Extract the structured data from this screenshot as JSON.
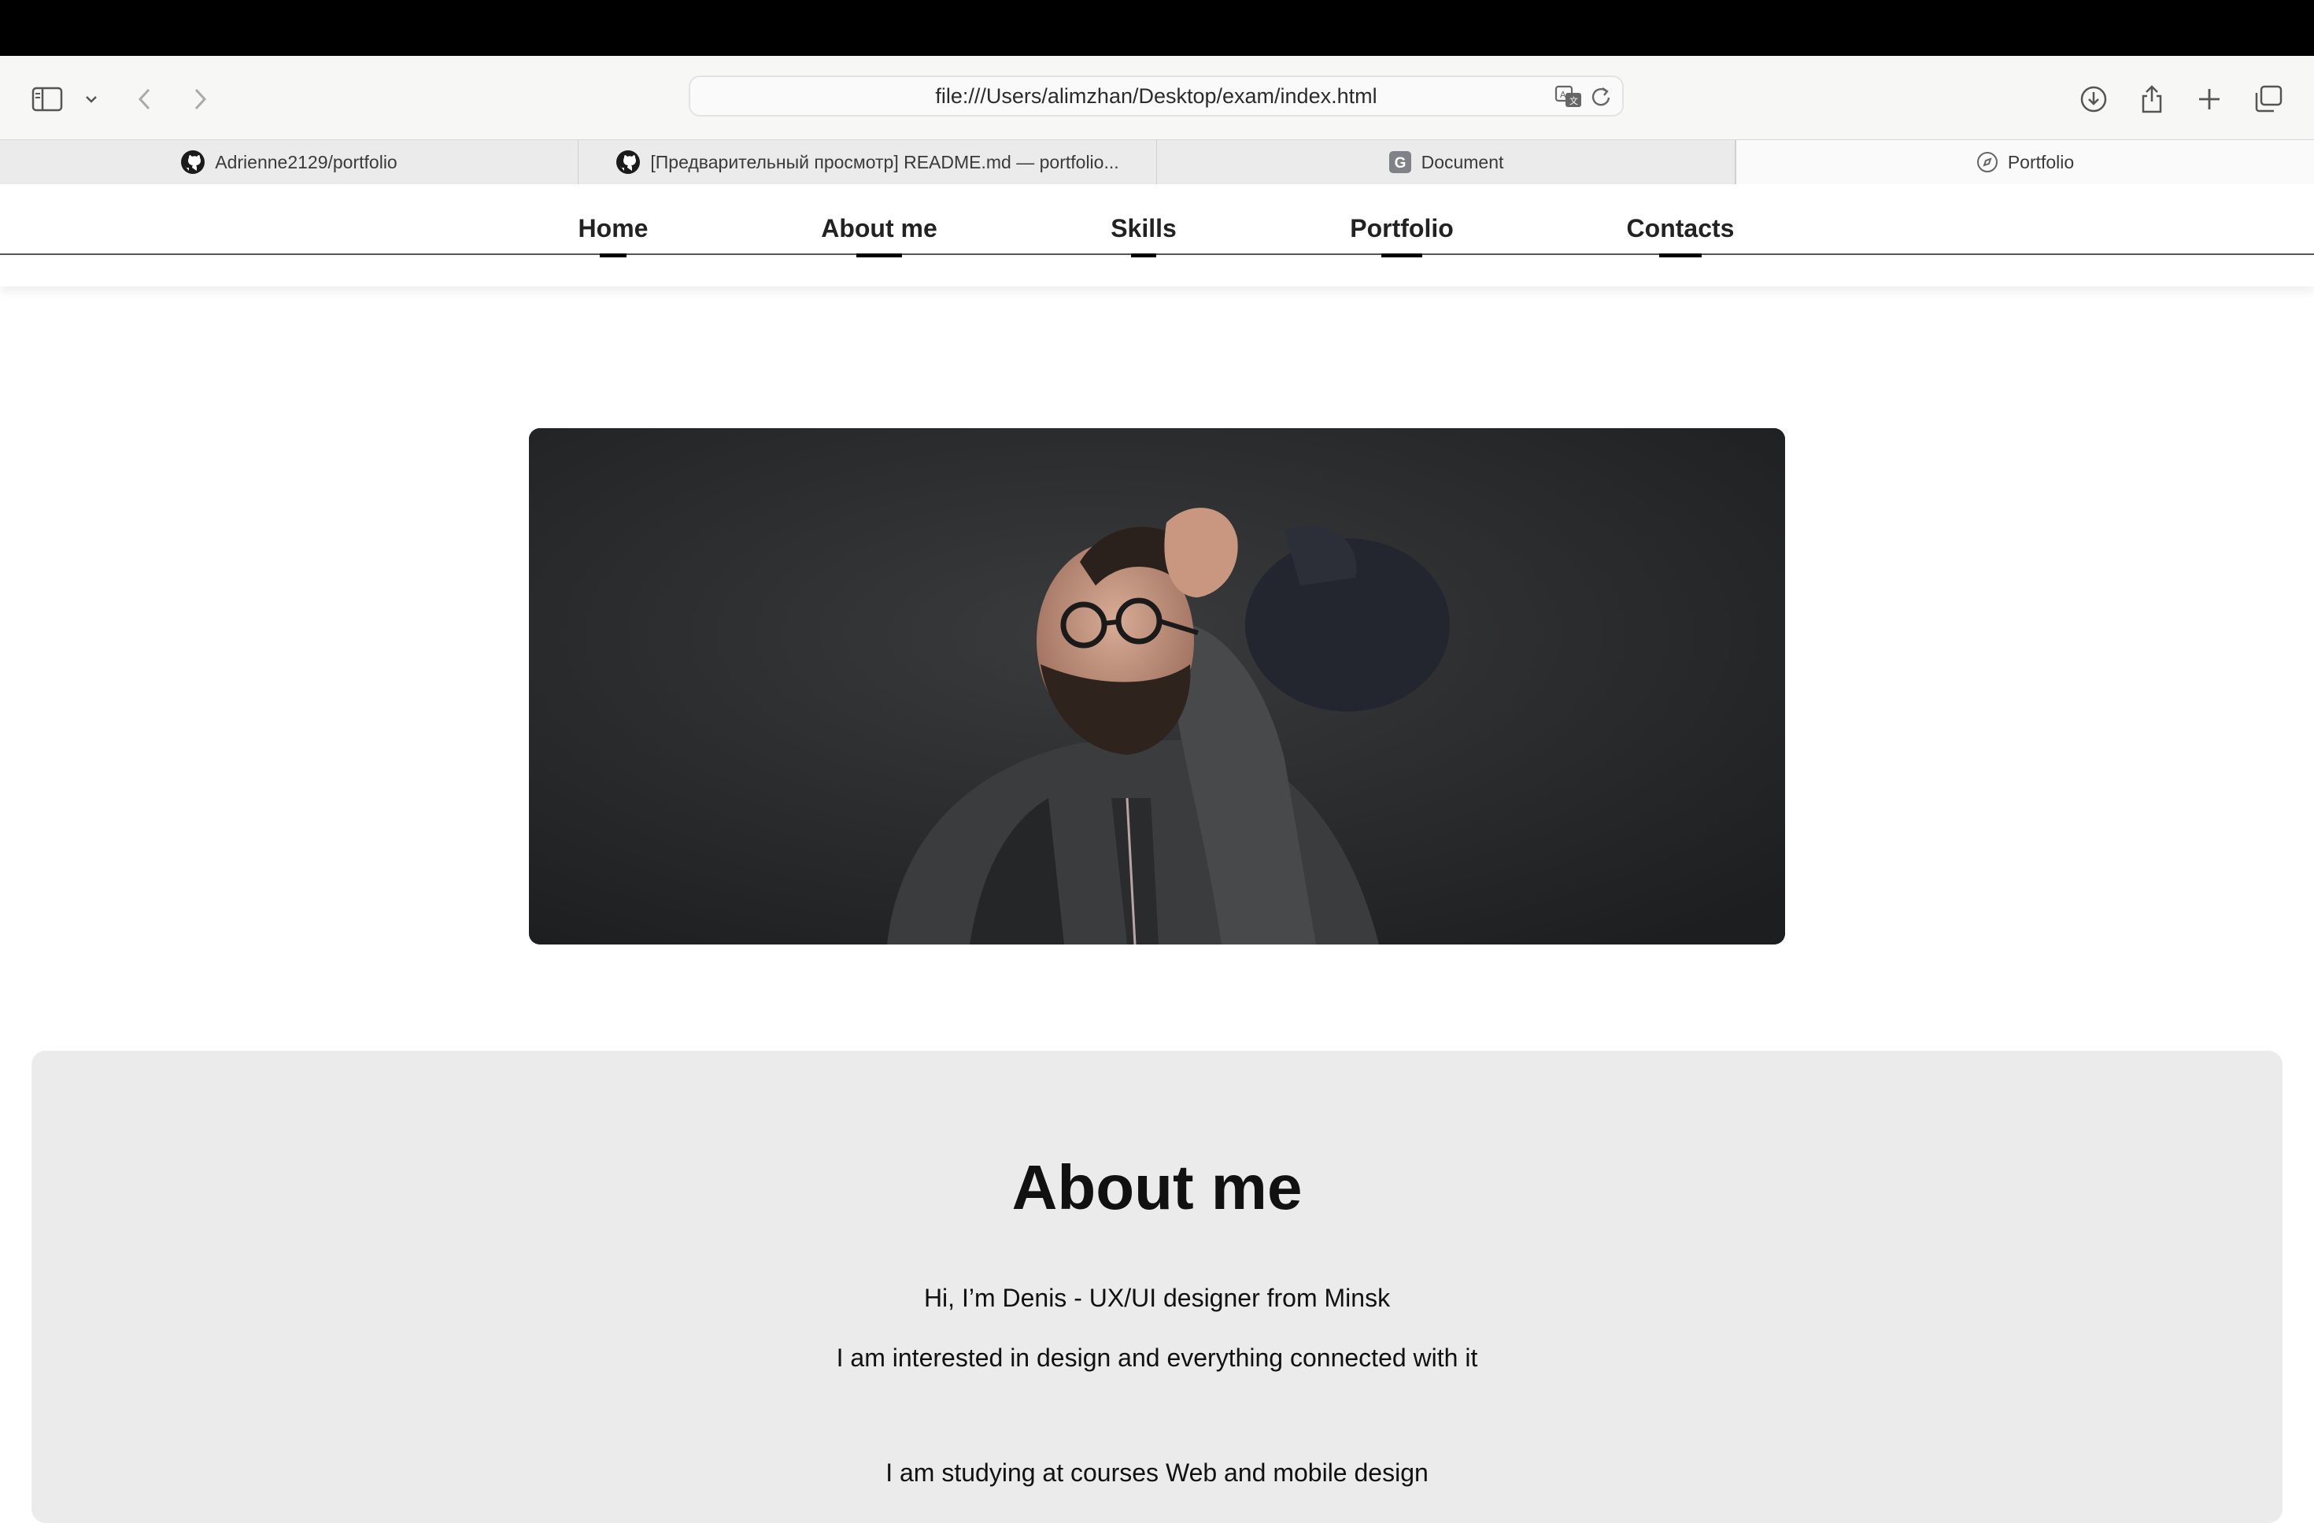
{
  "browser": {
    "url": "file:///Users/alimzhan/Desktop/exam/index.html",
    "tabs": [
      {
        "label": "Adrienne2129/portfolio",
        "icon": "github-icon"
      },
      {
        "label": "[Предварительный просмотр] README.md — portfolio...",
        "icon": "github-icon"
      },
      {
        "label": "Document",
        "icon": "google-doc-icon",
        "icon_letter": "G"
      },
      {
        "label": "Portfolio",
        "icon": "compass-icon",
        "active": true
      }
    ]
  },
  "nav": {
    "items": [
      "Home",
      "About me",
      "Skills",
      "Portfolio",
      "Contacts"
    ]
  },
  "hero": {
    "image": "portrait-photo"
  },
  "about": {
    "title": "About me",
    "lines": [
      "Hi, I’m Denis - UX/UI designer from Minsk",
      "I am interested in design and everything connected with it",
      "I am studying at courses Web and mobile design"
    ]
  },
  "colors": {
    "about_bg": "#ebebeb",
    "nav_underline": "#000000",
    "toolbar_bg": "#f7f7f6"
  }
}
